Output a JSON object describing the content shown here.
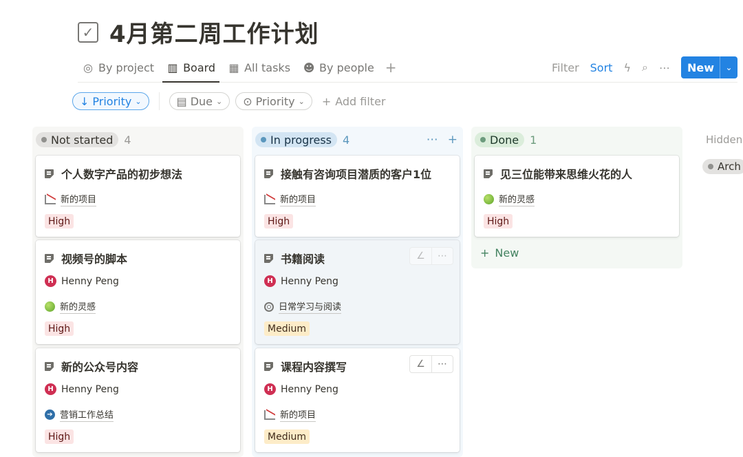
{
  "page": {
    "title": "4月第二周工作计划",
    "title_icon": "checkbox-icon"
  },
  "views": [
    {
      "label": "By project",
      "icon": "target-icon",
      "active": false
    },
    {
      "label": "Board",
      "icon": "board-icon",
      "active": true
    },
    {
      "label": "All tasks",
      "icon": "table-icon",
      "active": false
    },
    {
      "label": "By people",
      "icon": "people-icon",
      "active": false
    }
  ],
  "toolbar": {
    "filter_label": "Filter",
    "sort_label": "Sort",
    "new_label": "New"
  },
  "filters": {
    "sort_chip": "Priority",
    "due_chip": "Due",
    "priority_chip": "Priority",
    "add_filter": "Add filter"
  },
  "columns": [
    {
      "status": "Not started",
      "count": "4",
      "color": "#e3e2e0",
      "cards": [
        {
          "title": "个人数字产品的初步想法",
          "props": [
            {
              "kind": "relation",
              "icon": "chart-emoji",
              "text": "新的项目"
            }
          ],
          "priority": "High"
        },
        {
          "title": "视频号的脚本",
          "props": [
            {
              "kind": "person",
              "initial": "H",
              "text": "Henny Peng"
            },
            {
              "kind": "relation",
              "icon": "apple-emoji",
              "text": "新的灵感"
            }
          ],
          "priority": "High"
        },
        {
          "title": "新的公众号内容",
          "props": [
            {
              "kind": "person",
              "initial": "H",
              "text": "Henny Peng"
            },
            {
              "kind": "relation",
              "icon": "arrow-emoji",
              "text": "营销工作总结"
            }
          ],
          "priority": "High"
        }
      ]
    },
    {
      "status": "In progress",
      "count": "4",
      "color": "#d3e5f3",
      "cards": [
        {
          "title": "接触有咨询项目潜质的客户1位",
          "props": [
            {
              "kind": "relation",
              "icon": "chart-emoji",
              "text": "新的项目"
            }
          ],
          "priority": "High"
        },
        {
          "title": "书籍阅读",
          "props": [
            {
              "kind": "person",
              "initial": "H",
              "text": "Henny Peng"
            },
            {
              "kind": "relation",
              "icon": "target-icon",
              "text": "日常学习与阅读"
            }
          ],
          "priority": "Medium"
        },
        {
          "title": "课程内容撰写",
          "props": [
            {
              "kind": "person",
              "initial": "H",
              "text": "Henny Peng"
            },
            {
              "kind": "relation",
              "icon": "chart-emoji",
              "text": "新的项目"
            }
          ],
          "priority": "Medium"
        }
      ]
    },
    {
      "status": "Done",
      "count": "1",
      "color": "#dbeddb",
      "cards": [
        {
          "title": "见三位能带来思维火花的人",
          "props": [
            {
              "kind": "relation",
              "icon": "apple-emoji",
              "text": "新的灵感"
            }
          ],
          "priority": "High"
        }
      ],
      "new_label": "New"
    }
  ],
  "hidden": {
    "label": "Hidden",
    "group": "Arch"
  }
}
